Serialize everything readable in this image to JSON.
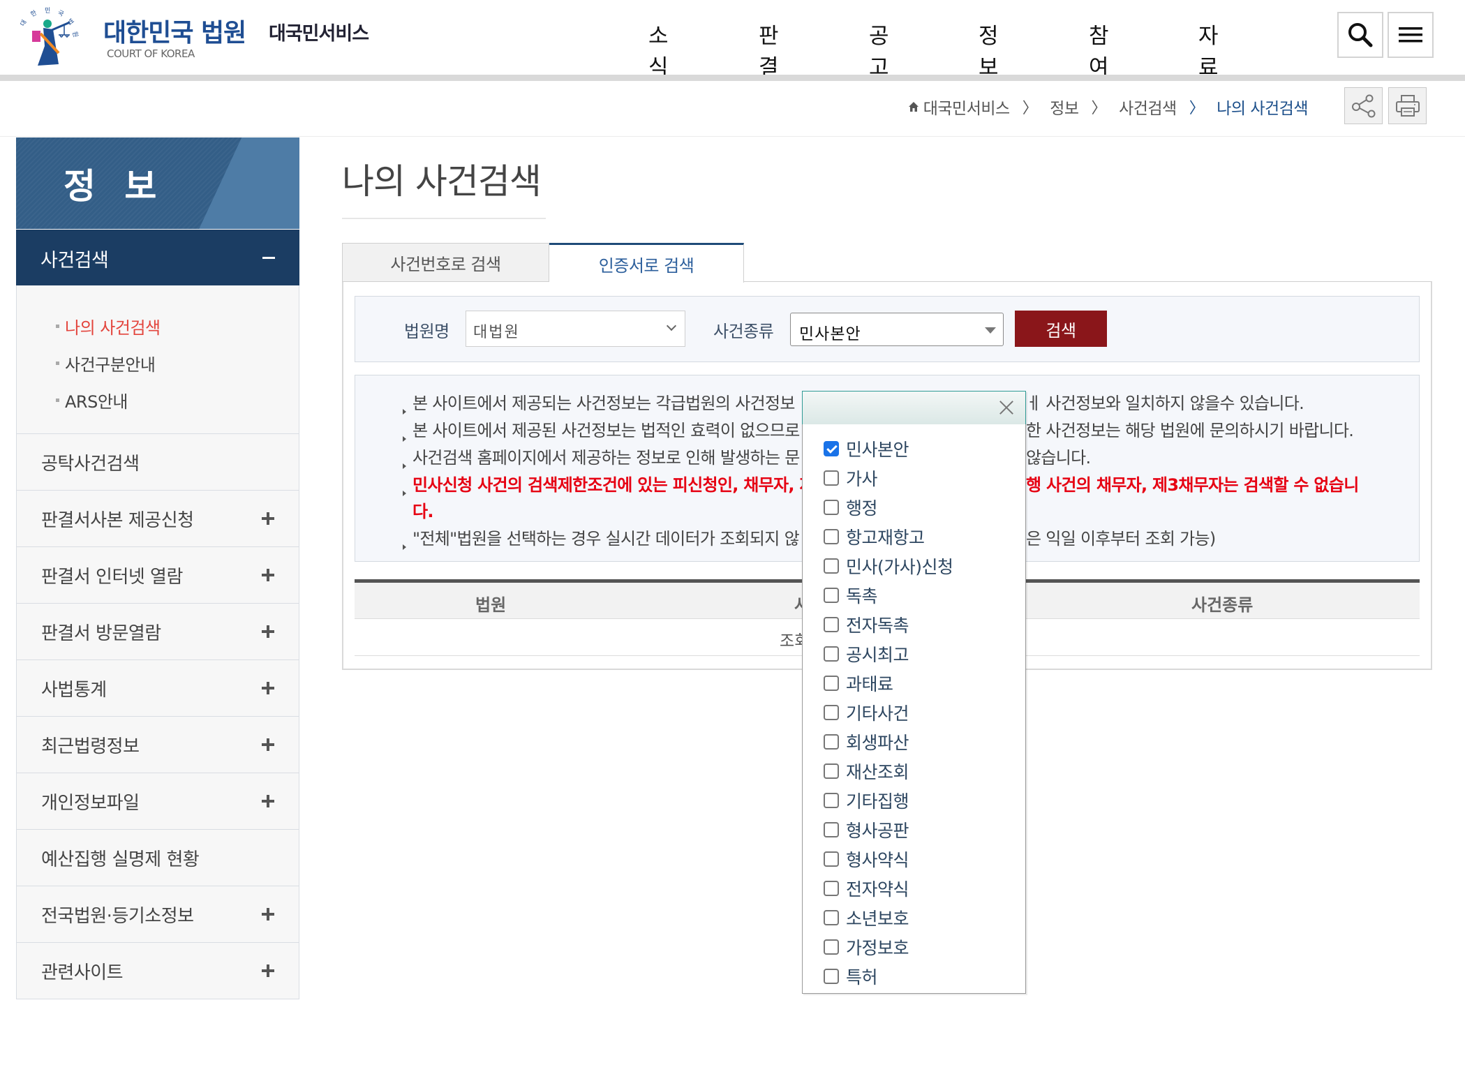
{
  "header": {
    "brand_title": "대한민국 법원",
    "brand_sub": "COURT OF KOREA",
    "service_name": "대국민서비스",
    "nav": [
      "소식",
      "판결",
      "공고",
      "정보",
      "참여",
      "자료"
    ],
    "search_icon": "search-icon",
    "menu_icon": "hamburger-menu-icon"
  },
  "breadcrumb": {
    "items": [
      "대국민서비스",
      "정보",
      "사건검색",
      "나의 사건검색"
    ],
    "separator": "〉",
    "share_icon": "share-icon",
    "print_icon": "print-icon"
  },
  "sidebar": {
    "title": "정 보",
    "active_section": "사건검색",
    "sub_items": [
      {
        "label": "나의 사건검색",
        "active": true
      },
      {
        "label": "사건구분안내",
        "active": false
      },
      {
        "label": "ARS안내",
        "active": false
      }
    ],
    "items": [
      {
        "label": "공탁사건검색",
        "expandable": false
      },
      {
        "label": "판결서사본 제공신청",
        "expandable": true
      },
      {
        "label": "판결서 인터넷 열람",
        "expandable": true
      },
      {
        "label": "판결서 방문열람",
        "expandable": true
      },
      {
        "label": "사법통계",
        "expandable": true
      },
      {
        "label": "최근법령정보",
        "expandable": true
      },
      {
        "label": "개인정보파일",
        "expandable": true
      },
      {
        "label": "예산집행 실명제 현황",
        "expandable": false
      },
      {
        "label": "전국법원·등기소정보",
        "expandable": true
      },
      {
        "label": "관련사이트",
        "expandable": true
      }
    ]
  },
  "main": {
    "page_title": "나의 사건검색",
    "tabs": [
      {
        "label": "사건번호로 검색",
        "active": false
      },
      {
        "label": "인증서로 검색",
        "active": true
      }
    ],
    "search": {
      "court_label": "법원명",
      "court_value": "대법원",
      "type_label": "사건종류",
      "type_value": "민사본안",
      "search_button": "검색"
    },
    "notices": [
      {
        "left": "본 사이트에서 제공되는 사건정보는 각급법원의 사건정보",
        "right": "ㅔ 사건정보와 일치하지 않을수 있습니다.",
        "emphasis": false
      },
      {
        "left": "본 사이트에서 제공된 사건정보는 법적인 효력이 없으므로",
        "right": "한 사건정보는 해당 법원에 문의하시기 바랍니다.",
        "emphasis": false
      },
      {
        "left": "사건검색 홈페이지에서 제공하는 정보로 인해 발생하는 문",
        "right": "않습니다.",
        "emphasis": false
      },
      {
        "left": "민사신청 사건의 검색제한조건에 있는 피신청인, 채무자, 제",
        "right": "행 사건의 채무자, 제3채무자는 검색할 수 없습니",
        "emphasis": true
      },
      {
        "left": "다.",
        "right": "",
        "emphasis": true,
        "continuation": true
      },
      {
        "left": "\"전체\"법원을 선택하는 경우 실시간 데이터가 조회되지 않",
        "right": "은 익일 이후부터 조회 가능)",
        "emphasis": false
      }
    ],
    "table": {
      "headers": [
        "법원",
        "사",
        "사건종류"
      ],
      "empty_message": "조회"
    }
  },
  "dropdown": {
    "close_icon": "close-icon",
    "options": [
      {
        "label": "민사본안",
        "checked": true
      },
      {
        "label": "가사",
        "checked": false
      },
      {
        "label": "행정",
        "checked": false
      },
      {
        "label": "항고재항고",
        "checked": false
      },
      {
        "label": "민사(가사)신청",
        "checked": false
      },
      {
        "label": "독촉",
        "checked": false
      },
      {
        "label": "전자독촉",
        "checked": false
      },
      {
        "label": "공시최고",
        "checked": false
      },
      {
        "label": "과태료",
        "checked": false
      },
      {
        "label": "기타사건",
        "checked": false
      },
      {
        "label": "회생파산",
        "checked": false
      },
      {
        "label": "재산조회",
        "checked": false
      },
      {
        "label": "기타집행",
        "checked": false
      },
      {
        "label": "형사공판",
        "checked": false
      },
      {
        "label": "형사약식",
        "checked": false
      },
      {
        "label": "전자약식",
        "checked": false
      },
      {
        "label": "소년보호",
        "checked": false
      },
      {
        "label": "가정보호",
        "checked": false
      },
      {
        "label": "특허",
        "checked": false
      }
    ]
  },
  "colors": {
    "brand_blue": "#1f4e93",
    "sidebar_active": "#1b3d63",
    "sidebar_header": "#335e87",
    "active_sub_item": "#e3443c",
    "search_button": "#8a161a",
    "notice_emphasis": "#e60012",
    "checkbox_checked": "#1a73e8"
  }
}
